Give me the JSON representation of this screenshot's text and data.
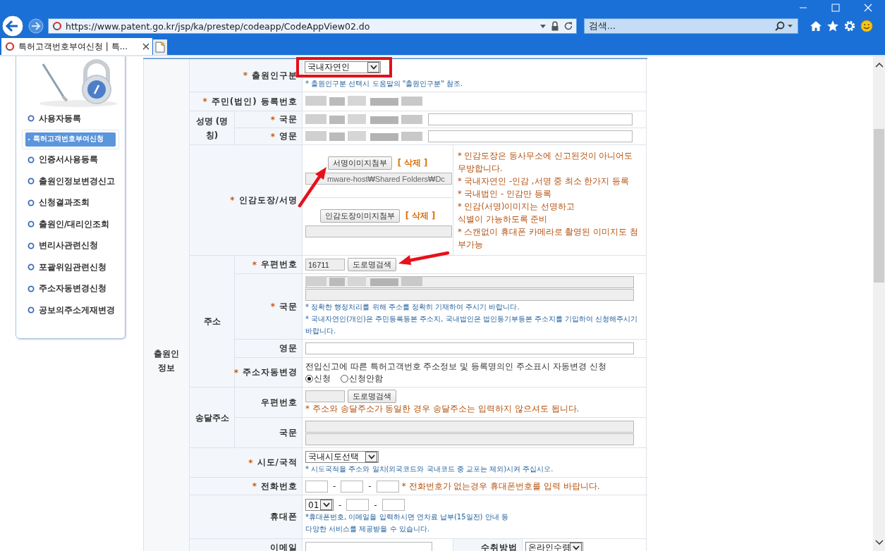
{
  "browser": {
    "url": "https://www.patent.go.kr/jsp/ka/prestep/codeapp/CodeAppView02.do",
    "search_placeholder": "검색...",
    "tabs": [
      {
        "title": "특허고객번호부여신청 | 특...",
        "selected": true
      }
    ]
  },
  "sidebar": {
    "items": [
      {
        "label": "사용자등록",
        "selected": false
      },
      {
        "label": "특허고객번호부여신청",
        "selected": true
      },
      {
        "label": "인증서사용등록",
        "selected": false
      },
      {
        "label": "출원인정보변경신고",
        "selected": false
      },
      {
        "label": "신청결과조회",
        "selected": false
      },
      {
        "label": "출원인/대리인조회",
        "selected": false
      },
      {
        "label": "변리사관련신청",
        "selected": false
      },
      {
        "label": "포괄위임관련신청",
        "selected": false
      },
      {
        "label": "주소자동변경신청",
        "selected": false
      },
      {
        "label": "공보의주소게재변경",
        "selected": false
      }
    ]
  },
  "form": {
    "section": "출원인 정보",
    "applicant_type": {
      "mark": "*",
      "label": "출원인구분",
      "value": "국내자연인",
      "highlighted": true,
      "note": "* 출원인구분 선택시 도움말의 \"출원인구분\" 참조."
    },
    "registration_number": {
      "mark": "*",
      "label": "주민(법인) 등록번호",
      "redacted": true
    },
    "name": {
      "group": "성명 (명칭)",
      "rows": [
        {
          "mark": "*",
          "label": "국문",
          "redacted": true
        },
        {
          "mark": "*",
          "label": "영문",
          "redacted": true
        }
      ]
    },
    "seal": {
      "mark": "*",
      "label": "인감도장/서명",
      "uploads": [
        {
          "button": "서명이미지첨부",
          "delete": "[ 삭제 ]",
          "path": "mware-host₩Shared Folders₩Dc",
          "arrow": true
        },
        {
          "button": "인감도장이미지첨부",
          "delete": "[ 삭제 ]"
        }
      ],
      "notes": [
        "* 인감도장은 동사무소에 신고된것이 아니어도 무방합니다.",
        "* 국내자연인 -인감 ,서명 중 최소 한가지 등록",
        "* 국내법인 - 인감만 등록",
        "* 인감(서명)이미지는 선명하고",
        "식별이 가능하도록 준비",
        "* 스캔없이 휴대폰 카메라로 촬영된 이미지도 첨부가능"
      ]
    },
    "address": {
      "group": "주소",
      "postcode": {
        "mark": "*",
        "label": "우편번호",
        "value": "16711",
        "button": "도로명검색",
        "arrow": true
      },
      "korean": {
        "mark": "*",
        "label": "국문",
        "redacted": true,
        "notes": [
          "* 정확한 행정처리를 위해 주소를 정확히 기재하여 주시기 바랍니다.",
          "* 국내자연인(개인)은 주민등록등본 주소지, 국내법인은 법인등기부등본 주소지를 기입하여 신청해주시기 바랍니다."
        ]
      },
      "english": {
        "label": "영문"
      },
      "auto_change": {
        "mark": "*",
        "label": "주소자동변경",
        "text": "전입신고에 따른 특허고객번호 주소정보 및 등록명의인 주소표시 자동변경 신청",
        "options": [
          {
            "label": "신청",
            "selected": true
          },
          {
            "label": "신청안함",
            "selected": false
          }
        ]
      }
    },
    "delivery": {
      "group": "송달주소",
      "postcode": {
        "label": "우편번호",
        "button": "도로명검색",
        "note": "* 주소와 송달주소가 동일한 경우 송달주소는 입력하지 않으셔도 됩니다."
      },
      "korean": {
        "label": "국문"
      }
    },
    "region": {
      "mark": "*",
      "label": "시도/국적",
      "value": "국내시도선택",
      "note": "* 시도국적을 주소와 일치(외국코드와 국내코드 중 교포는 제외)시켜 주십시오."
    },
    "phone": {
      "mark": "*",
      "label": "전화번호",
      "separator": "-",
      "note": "* 전화번호가 없는경우 휴대폰번호를 입력 바랍니다."
    },
    "mobile": {
      "label": "휴대폰",
      "prefix": "01",
      "separator": "-",
      "notes": [
        "*휴대폰번호, 이메일을 입력하시면 연차료 납부(15일전) 안내 등",
        "다양한 서비스를 제공받을 수 있습니다."
      ]
    },
    "email": {
      "label": "이메일",
      "receive_label": "수취방법",
      "receive_value": "온라인수령"
    }
  }
}
